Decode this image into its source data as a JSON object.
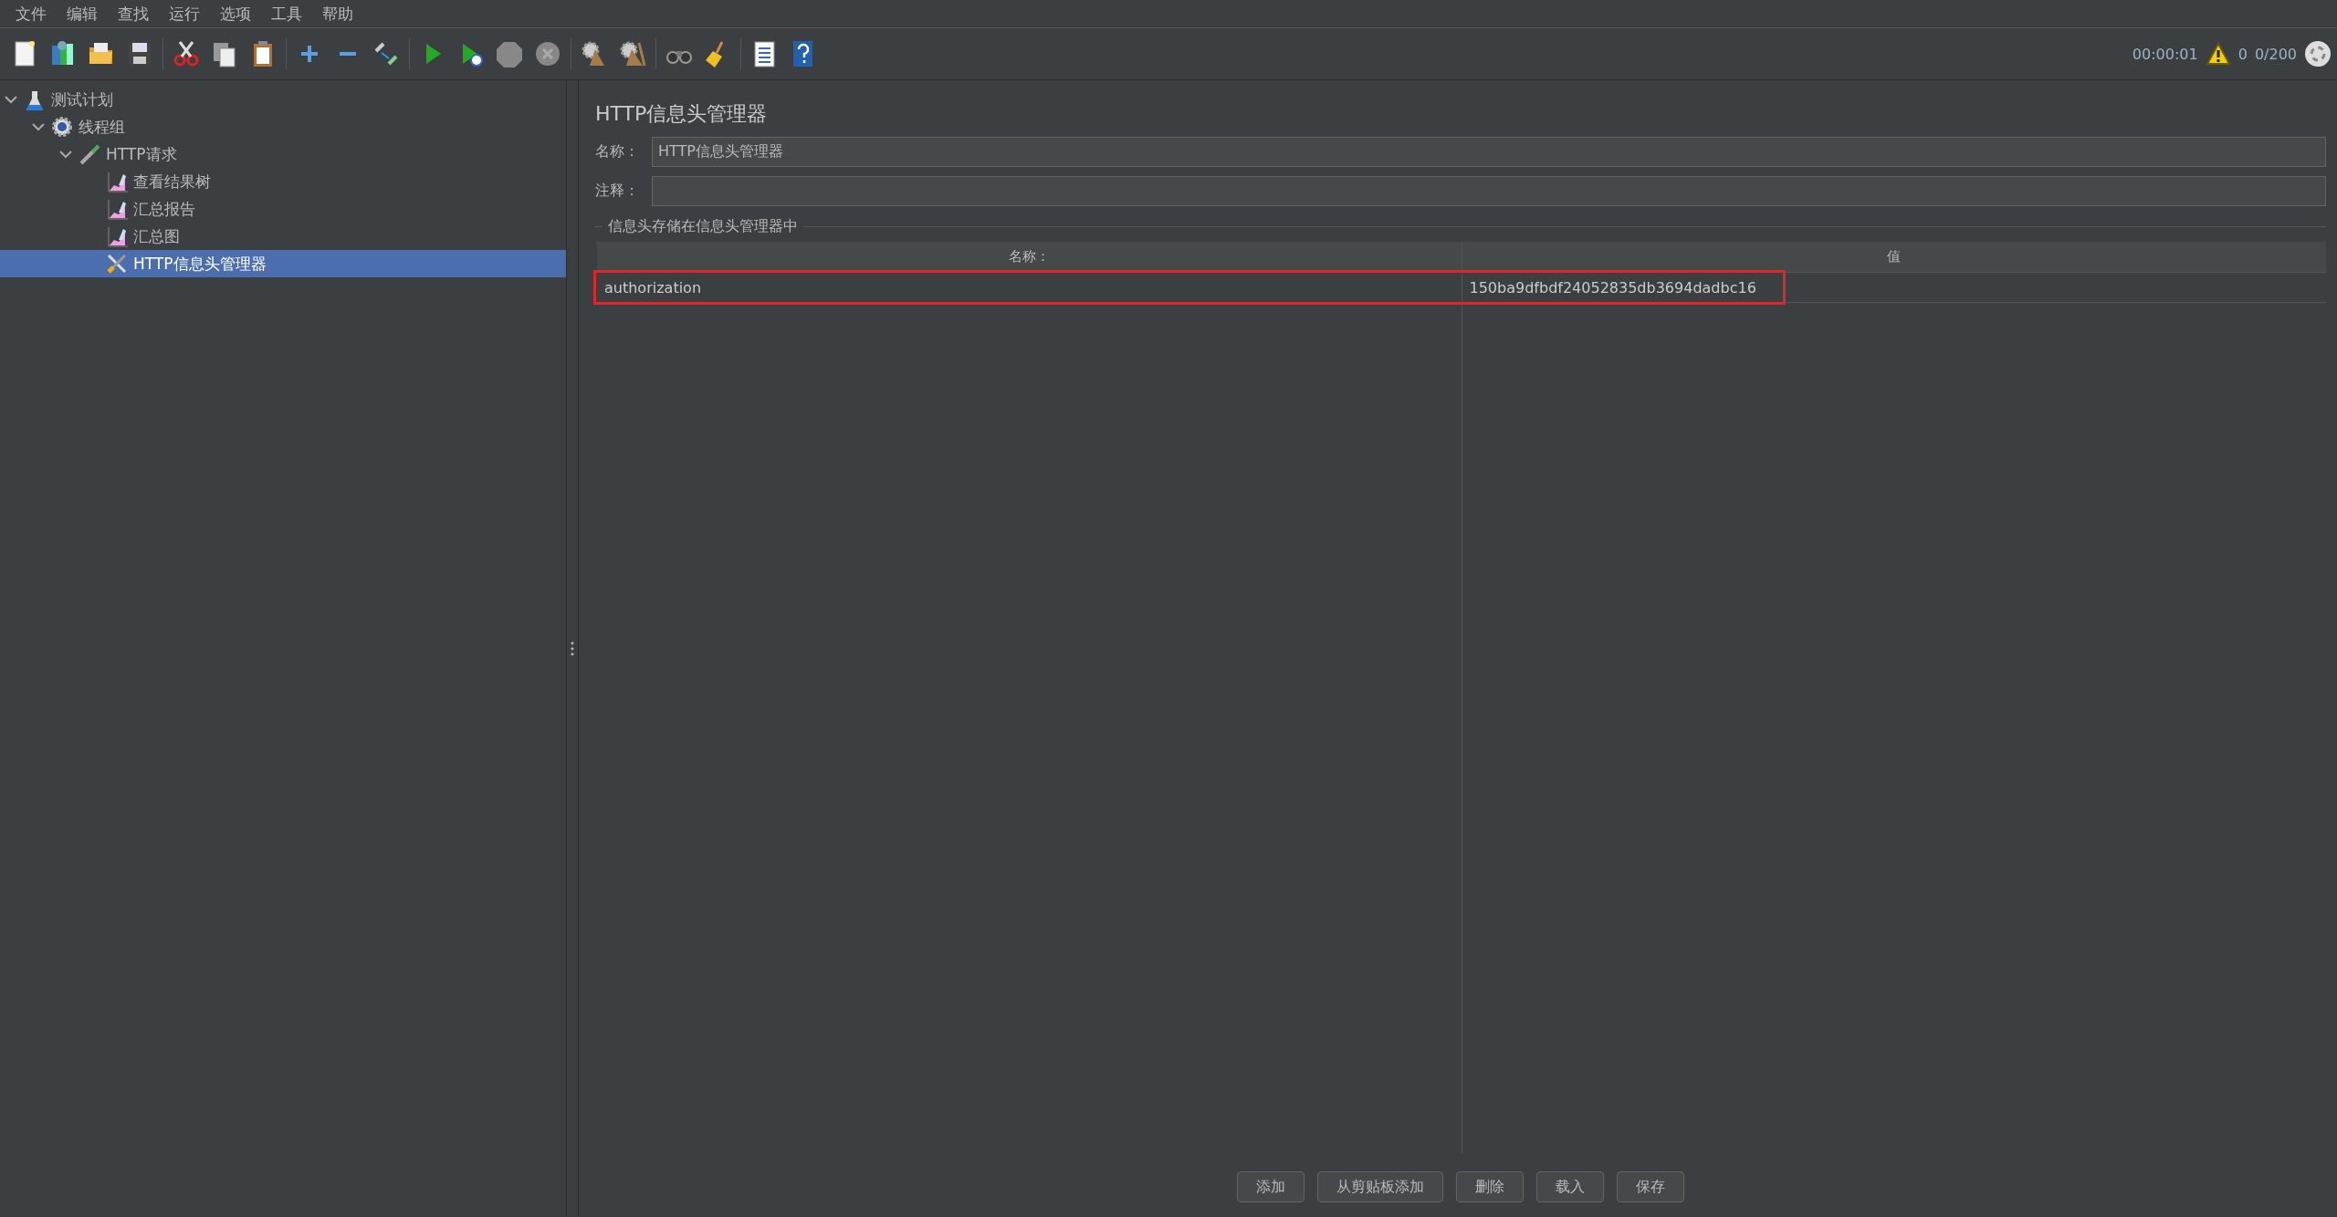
{
  "menu": [
    "文件",
    "编辑",
    "查找",
    "运行",
    "选项",
    "工具",
    "帮助"
  ],
  "status": {
    "elapsed": "00:00:01",
    "warnings": "0",
    "threads": "0/200"
  },
  "tree": [
    {
      "label": "测试计划",
      "kind": "plan",
      "expanded": true,
      "selected": false,
      "children": [
        {
          "label": "线程组",
          "kind": "thread-group",
          "expanded": true,
          "selected": false,
          "children": [
            {
              "label": "HTTP请求",
              "kind": "sampler",
              "expanded": true,
              "selected": false,
              "children": [
                {
                  "label": "查看结果树",
                  "kind": "listener",
                  "selected": false
                },
                {
                  "label": "汇总报告",
                  "kind": "listener",
                  "selected": false
                },
                {
                  "label": "汇总图",
                  "kind": "listener",
                  "selected": false
                },
                {
                  "label": "HTTP信息头管理器",
                  "kind": "config",
                  "selected": true
                }
              ]
            }
          ]
        }
      ]
    }
  ],
  "panel": {
    "title": "HTTP信息头管理器",
    "fields": [
      {
        "label": "名称：",
        "value": "HTTP信息头管理器"
      },
      {
        "label": "注释："
      }
    ],
    "group_title": "信息头存储在信息头管理器中",
    "table": {
      "columns": [
        "名称：",
        "值"
      ],
      "rows": [
        {
          "cells": [
            "authorization",
            "150ba9dfbdf24052835db3694dadbc16"
          ],
          "highlighted": true
        }
      ]
    },
    "buttons": [
      "添加",
      "从剪贴板添加",
      "删除",
      "载入",
      "保存"
    ]
  }
}
